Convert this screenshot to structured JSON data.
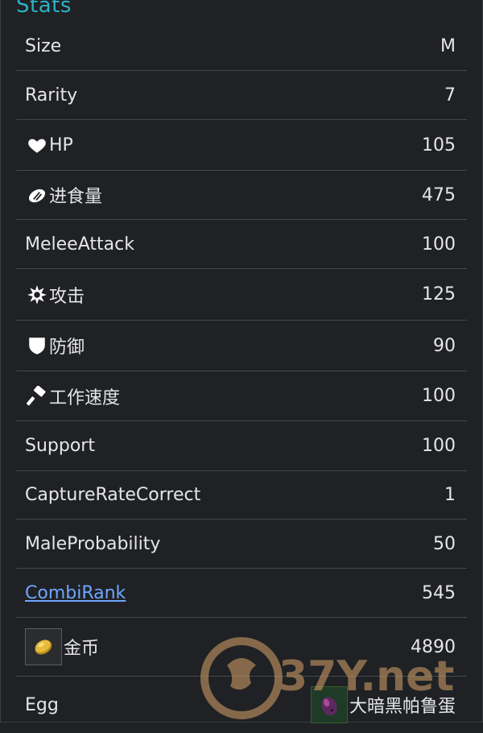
{
  "header": {
    "title": "Stats"
  },
  "rows": [
    {
      "label": "Size",
      "value": "M",
      "icon": null
    },
    {
      "label": "Rarity",
      "value": "7",
      "icon": null
    },
    {
      "label": "HP",
      "value": "105",
      "icon": "heart-icon"
    },
    {
      "label": "进食量",
      "value": "475",
      "icon": "food-icon"
    },
    {
      "label": "MeleeAttack",
      "value": "100",
      "icon": null
    },
    {
      "label": "攻击",
      "value": "125",
      "icon": "burst-icon"
    },
    {
      "label": "防御",
      "value": "90",
      "icon": "shield-icon"
    },
    {
      "label": "工作速度",
      "value": "100",
      "icon": "hammer-icon"
    },
    {
      "label": "Support",
      "value": "100",
      "icon": null
    },
    {
      "label": "CaptureRateCorrect",
      "value": "1",
      "icon": null
    },
    {
      "label": "MaleProbability",
      "value": "50",
      "icon": null
    },
    {
      "label": "CombiRank",
      "value": "545",
      "icon": null,
      "link": true
    },
    {
      "label": "金币",
      "value": "4890",
      "icon": "coin-icon"
    },
    {
      "label": "Egg",
      "value": "大暗黑帕鲁蛋",
      "icon": "egg-icon"
    }
  ],
  "watermark": {
    "text": "37Y.net"
  },
  "colors": {
    "accent": "#2bb3c8",
    "link": "#6ea6ff",
    "background": "#1f2124",
    "divider": "#45484c"
  }
}
